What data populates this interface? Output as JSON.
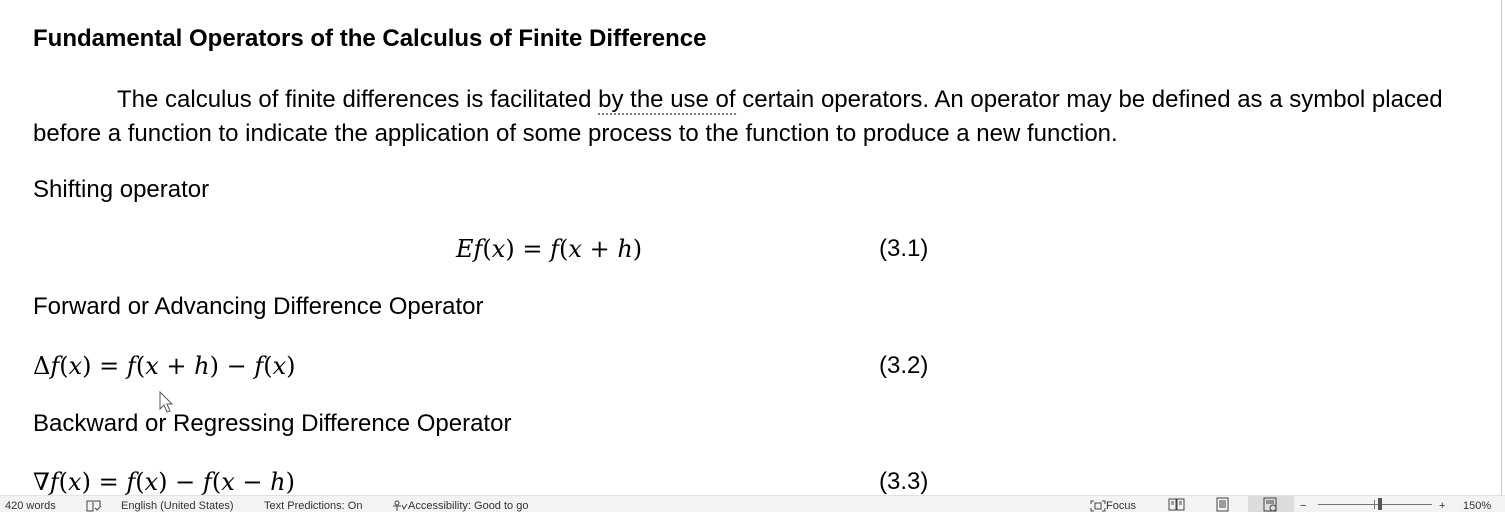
{
  "document": {
    "title": "Fundamental Operators of the Calculus of Finite Difference",
    "paragraph": {
      "before": "The calculus of finite differences is facilitated ",
      "underlined": "by the use of",
      "after": " certain operators. An operator may be defined as a symbol placed before a function to indicate the application of some process to the function to produce a new function."
    },
    "sections": [
      {
        "heading": "Shifting operator",
        "equation": "Ef(x) = f(x + h)",
        "number": "(3.1)"
      },
      {
        "heading": "Forward or Advancing Difference Operator",
        "equation": "Δf(x) = f(x + h) − f(x)",
        "number": "(3.2)"
      },
      {
        "heading": "Backward or Regressing Difference Operator",
        "equation": "∇f(x) = f(x) − f(x − h)",
        "number": "(3.3)"
      }
    ]
  },
  "statusbar": {
    "word_count": "420 words",
    "language": "English (United States)",
    "text_predictions": "Text Predictions: On",
    "accessibility": "Accessibility: Good to go",
    "focus": "Focus",
    "zoom_minus": "−",
    "zoom_plus": "+",
    "zoom_level": "150%",
    "zoom_value": 150
  },
  "colors": {
    "status_bg": "#f3f3f3",
    "dotted_underline": "#7a7a9a",
    "active_view": "#dcdcdc"
  }
}
